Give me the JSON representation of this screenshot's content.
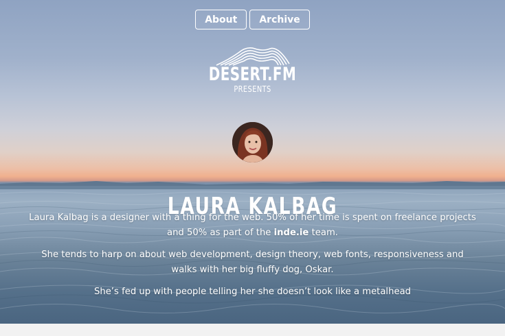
{
  "nav": {
    "items": [
      {
        "label": "About"
      },
      {
        "label": "Archive"
      }
    ]
  },
  "logo": {
    "name": "DESERT.FM",
    "sub": "PRESENTS"
  },
  "speaker": {
    "name": "LAURA KALBAG",
    "bio1_pre": "Laura Kalbag is a designer with a thing for the web. 50% of her time is spent on freelance projects and 50% as part of the ",
    "bio1_link": "inde.ie",
    "bio1_post": " team.",
    "bio2": "She tends to harp on about web development, design theory, web fonts, responsiveness and walks with her big fluffy dog, Oskar.",
    "bio3": "She’s fed up with people telling her she doesn’t look like a metalhead"
  },
  "colors": {
    "text": "#ffffff",
    "footer": "#f2f2f2"
  }
}
